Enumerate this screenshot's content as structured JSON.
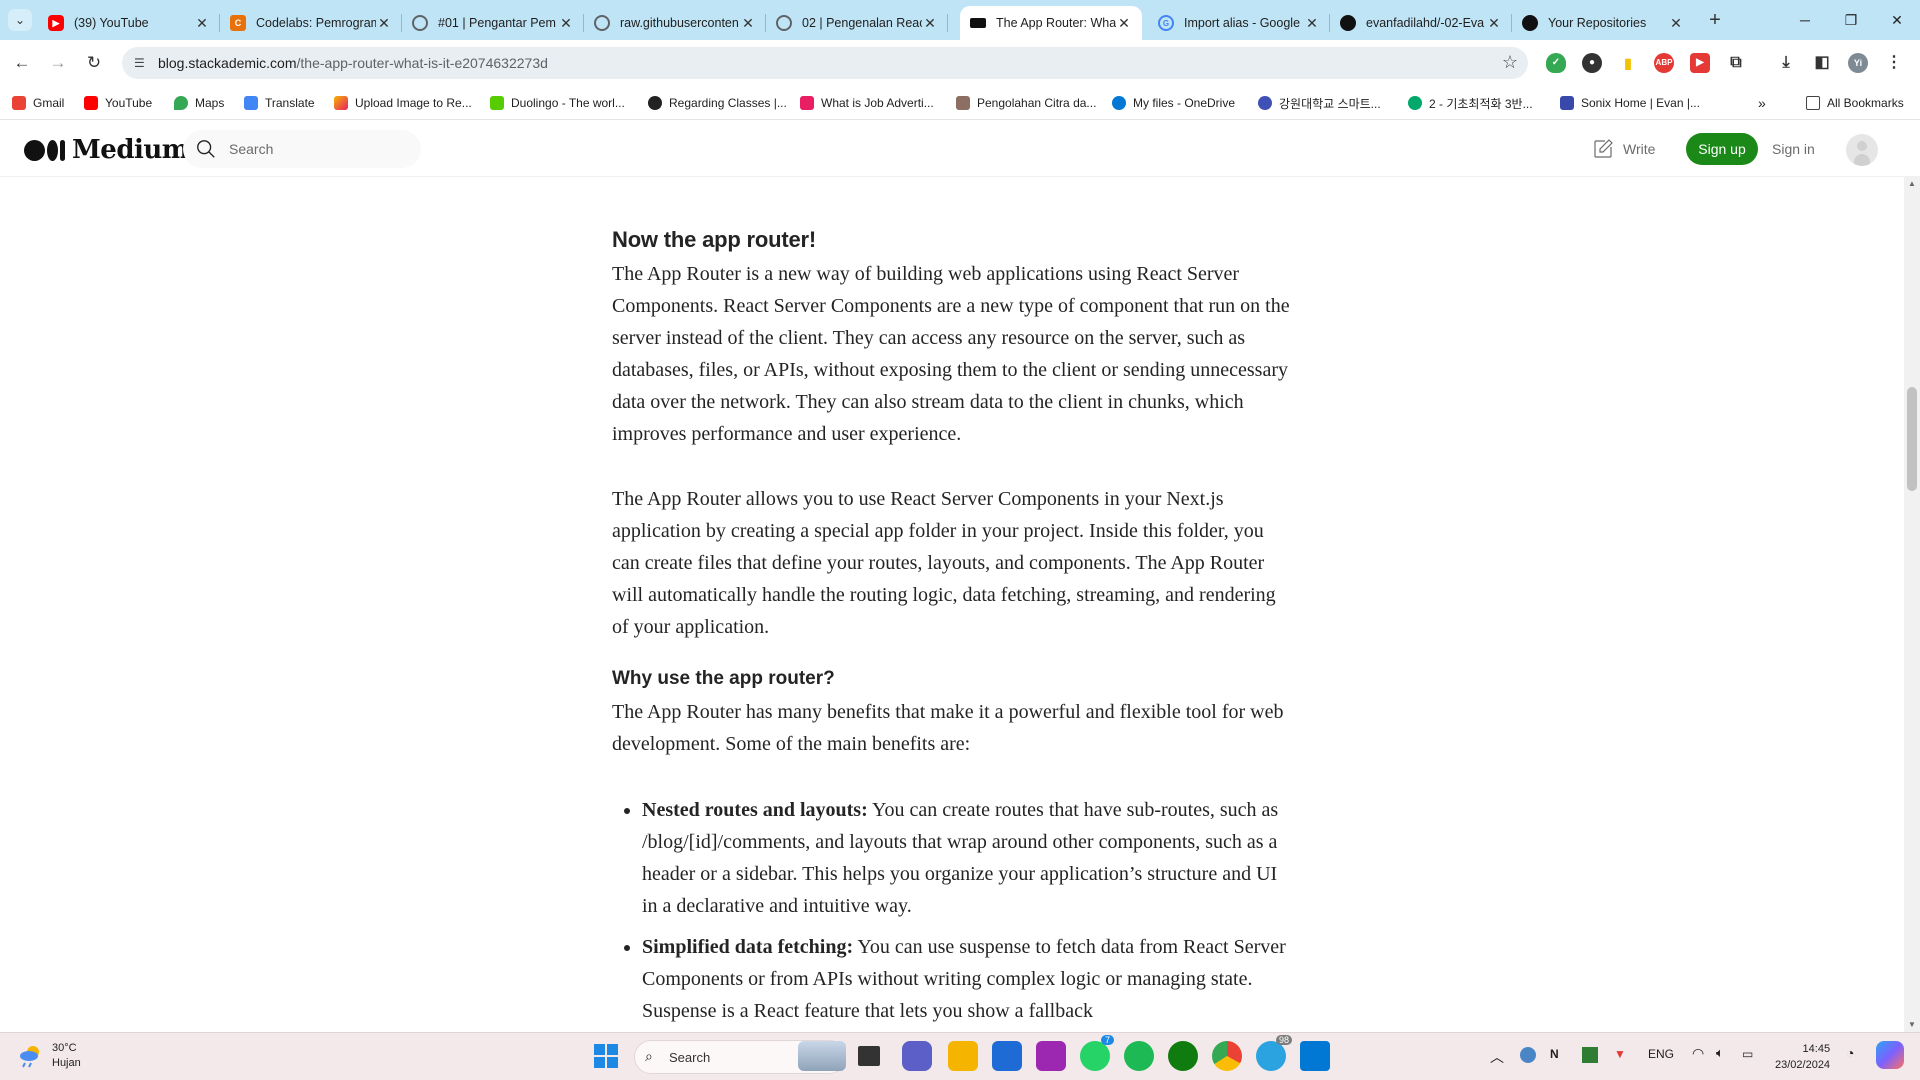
{
  "browser": {
    "tabs": [
      {
        "title": "(39) YouTube",
        "icon": "youtube-icon",
        "color": "#ff0000"
      },
      {
        "title": "Codelabs: Pemrogram",
        "icon": "codelabs-icon",
        "color": "#e8710a"
      },
      {
        "title": "#01 | Pengantar Pem",
        "icon": "globe-icon",
        "color": "#5f6368"
      },
      {
        "title": "raw.githubuserconten",
        "icon": "globe-icon",
        "color": "#5f6368"
      },
      {
        "title": "02 | Pengenalan Reac",
        "icon": "globe-icon",
        "color": "#5f6368"
      },
      {
        "title": "The App Router: Wha",
        "icon": "stackademic-icon",
        "color": "#111111",
        "active": true
      },
      {
        "title": "Import alias - Google",
        "icon": "google-icon",
        "color": "#4285f4"
      },
      {
        "title": "evanfadilahd/-02-Eva",
        "icon": "github-icon",
        "color": "#111111"
      },
      {
        "title": "Your Repositories",
        "icon": "github-icon",
        "color": "#111111"
      }
    ],
    "url": {
      "host": "blog.stackademic.com",
      "path": "/the-app-router-what-is-it-e2074632273d"
    },
    "profile_initial": "Yi",
    "bookmarks": [
      {
        "label": "Gmail",
        "color": "#ea4335"
      },
      {
        "label": "YouTube",
        "color": "#ff0000"
      },
      {
        "label": "Maps",
        "color": "#34a853"
      },
      {
        "label": "Translate",
        "color": "#4285f4"
      },
      {
        "label": "Upload Image to Re...",
        "color": "#f4b400"
      },
      {
        "label": "Duolingo - The worl...",
        "color": "#58cc02"
      },
      {
        "label": "Regarding Classes |...",
        "color": "#222222"
      },
      {
        "label": "What is Job Adverti...",
        "color": "#e91e63"
      },
      {
        "label": "Pengolahan Citra da...",
        "color": "#8d6e63"
      },
      {
        "label": "My files - OneDrive",
        "color": "#0078d4"
      },
      {
        "label": "강원대학교 스마트...",
        "color": "#3f51b5"
      },
      {
        "label": "2 - 기초최적화 3반...",
        "color": "#00a86b"
      },
      {
        "label": "Sonix Home | Evan |...",
        "color": "#3949ab"
      }
    ],
    "all_bookmarks": "All Bookmarks"
  },
  "medium": {
    "logo_text": "Medium",
    "search_placeholder": "Search",
    "write_label": "Write",
    "signup_label": "Sign up",
    "signin_label": "Sign in"
  },
  "article": {
    "section1_heading": "Now the app router!",
    "p1": "The App Router is a new way of building web applications using React Server Components. React Server Components are a new type of component that run on the server instead of the client. They can access any resource on the server, such as databases, files, or APIs, without exposing them to the client or sending unnecessary data over the network. They can also stream data to the client in chunks, which improves performance and user experience.",
    "p2": "The App Router allows you to use React Server Components in your Next.js application by creating a special app folder in your project. Inside this folder, you can create files that define your routes, layouts, and components. The App Router will automatically handle the routing logic, data fetching, streaming, and rendering of your application.",
    "section2_heading": "Why use the app router?",
    "p3": "The App Router has many benefits that make it a powerful and flexible tool for web development. Some of the main benefits are:",
    "benefits": [
      {
        "title": "Nested routes and layouts:",
        "text": " You can create routes that have sub-routes, such as /blog/[id]/comments, and layouts that wrap around other components, such as a header or a sidebar. This helps you organize your application’s structure and UI in a declarative and intuitive way."
      },
      {
        "title": "Simplified data fetching:",
        "text": " You can use suspense to fetch data from React Server Components or from APIs without writing complex logic or managing state. Suspense is a React feature that lets you show a fallback"
      }
    ]
  },
  "taskbar": {
    "weather_temp": "30°C",
    "weather_desc": "Hujan",
    "search_label": "Search",
    "language": "ENG",
    "time": "14:45",
    "date": "23/02/2024",
    "whatsapp_badge": "7",
    "telegram_badge": "98"
  }
}
